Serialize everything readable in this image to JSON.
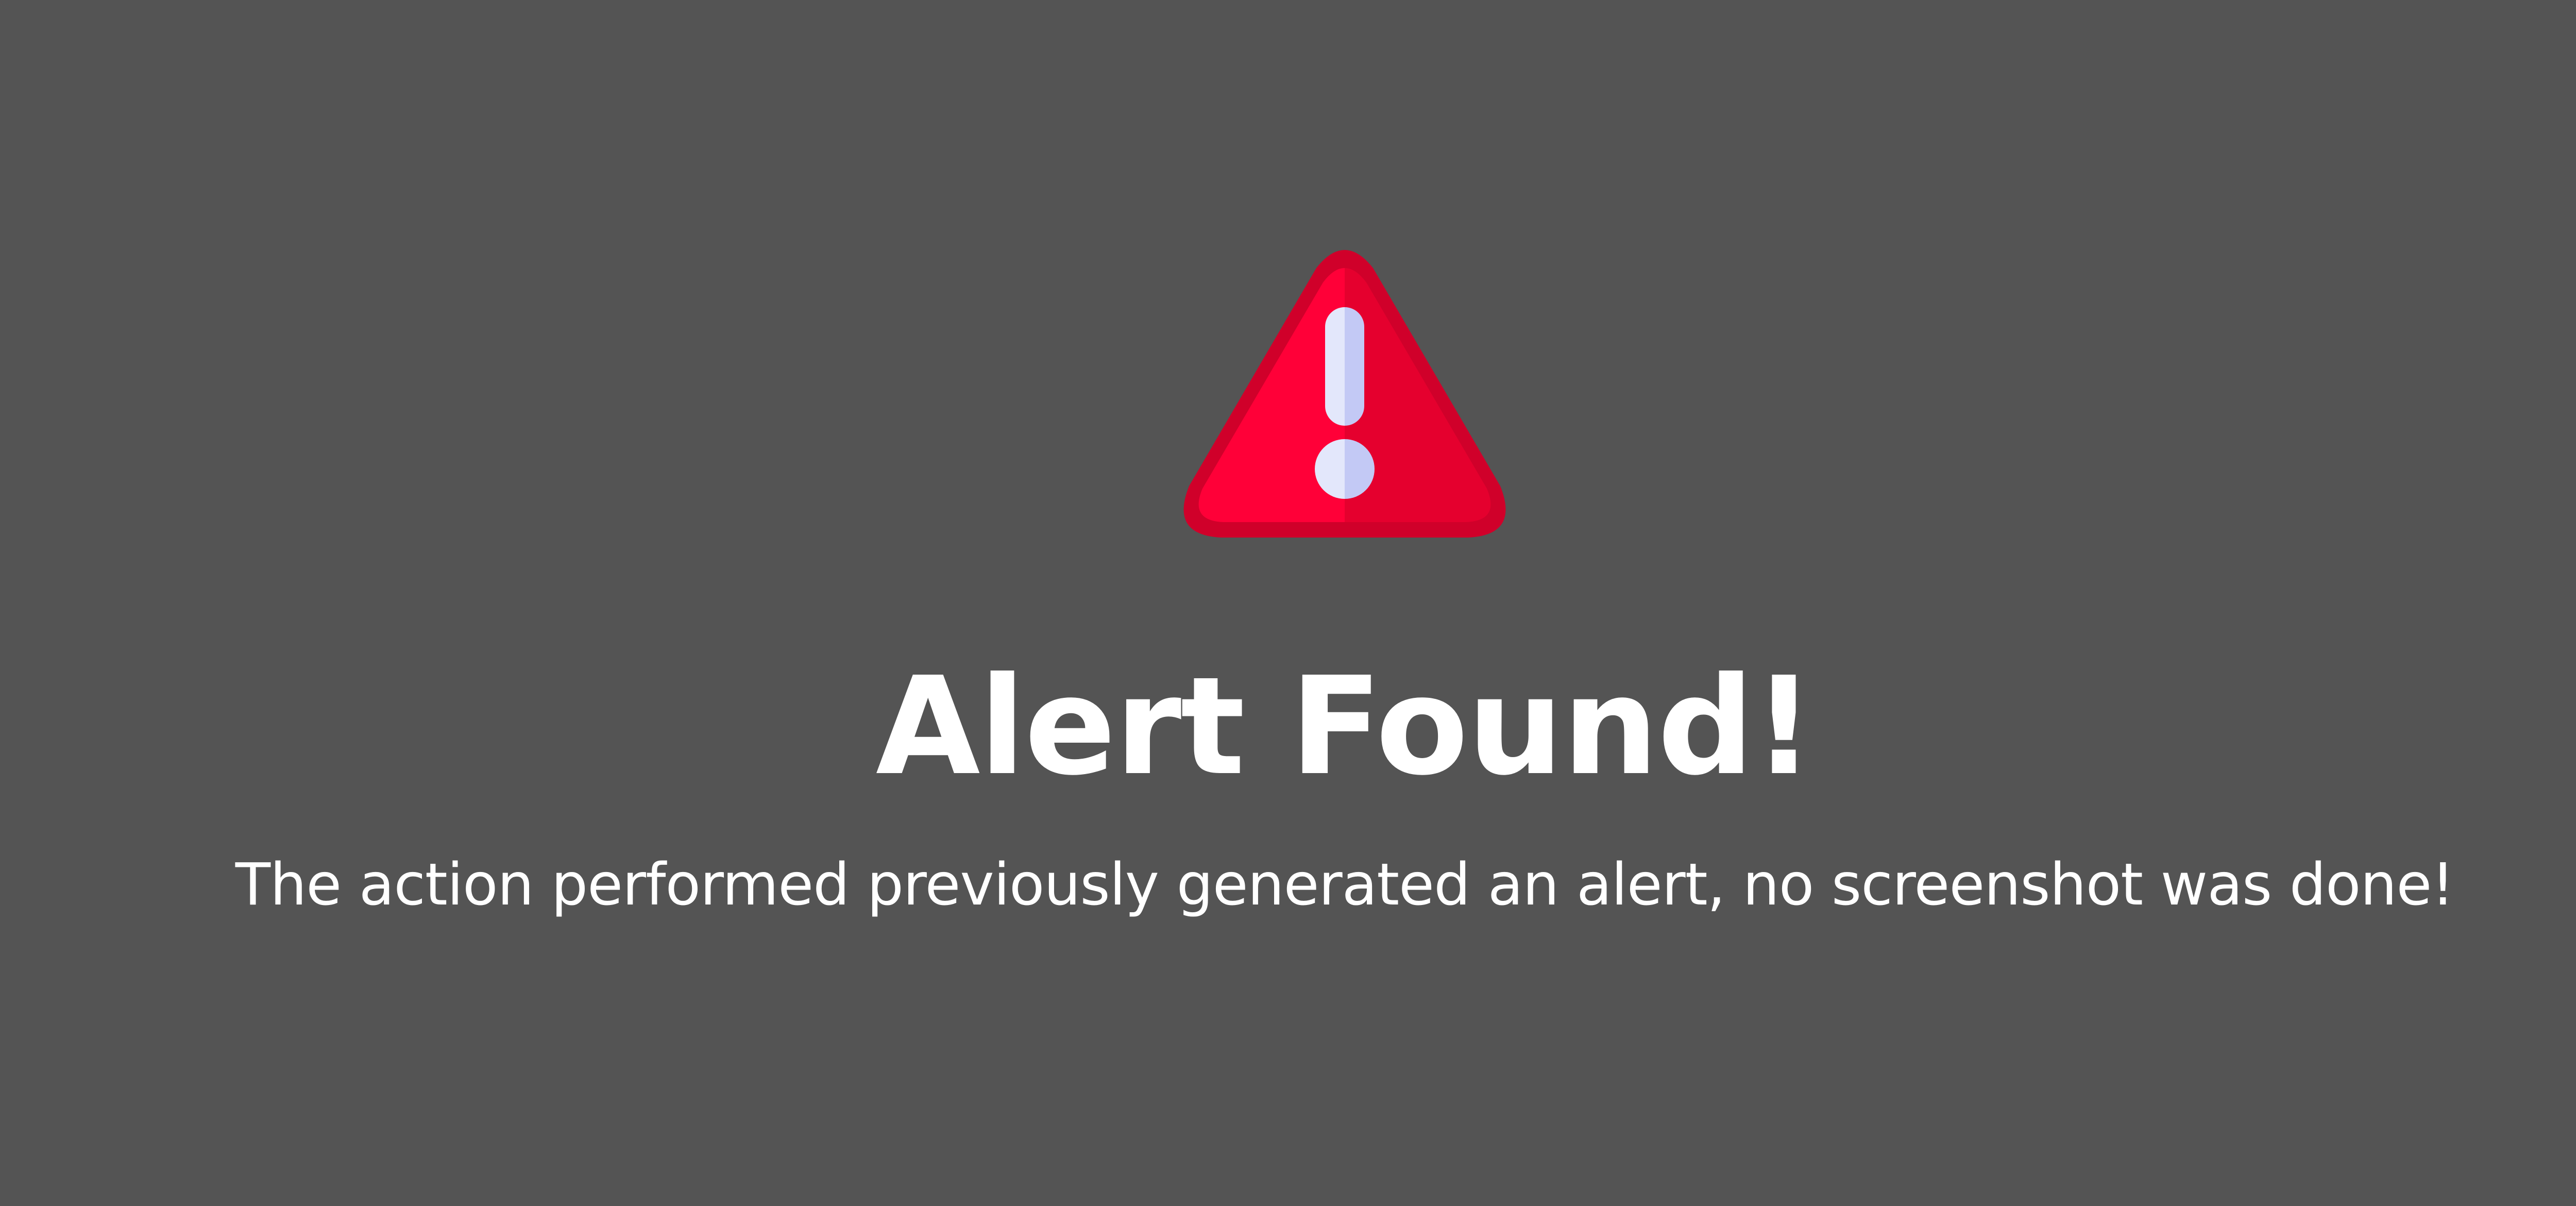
{
  "alert": {
    "icon": "warning-triangle-icon",
    "title": "Alert Found!",
    "message": "The action performed previously generated an alert, no screenshot was done!"
  },
  "colors": {
    "background": "#545454",
    "icon_red": "#ff0038",
    "icon_red_dark": "#d4002a",
    "icon_mark_light": "#e3e7fb",
    "icon_mark_shade": "#c3c9f5",
    "text": "#ffffff"
  }
}
